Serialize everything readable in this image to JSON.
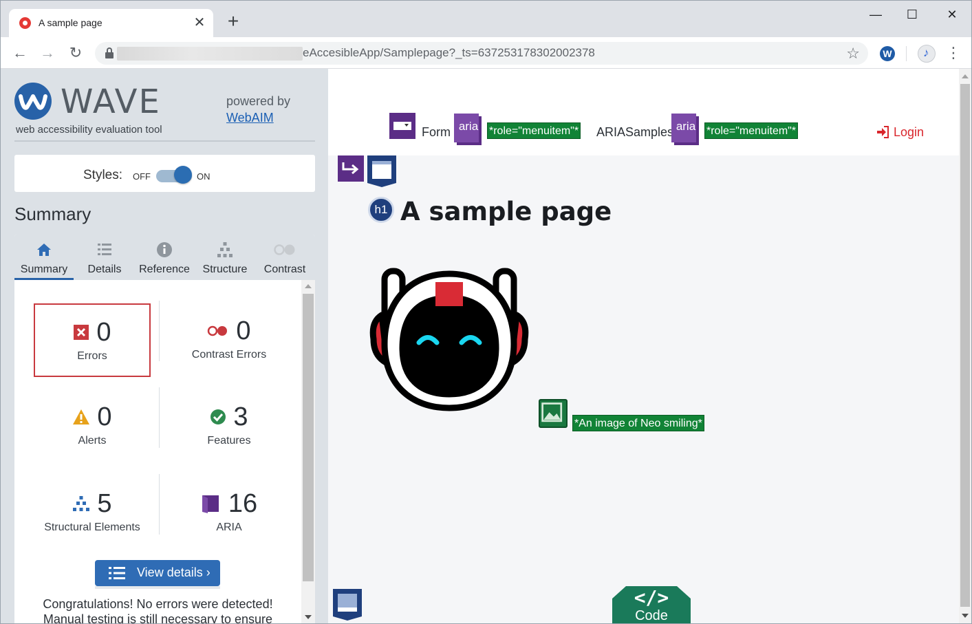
{
  "browser": {
    "tab_title": "A sample page",
    "tab_close": "✕",
    "new_tab": "+",
    "url_visible": "eAccesibleApp/Samplepage?_ts=637253178302002378",
    "window_controls": {
      "minimize": "—",
      "maximize": "☐",
      "close": "✕"
    },
    "nav": {
      "back": "←",
      "forward": "→",
      "reload": "↻"
    },
    "bookmark": "☆",
    "extension_icon": "W",
    "menu": "⋮",
    "favicon_color": "#e53935"
  },
  "wave": {
    "title": "WAVE",
    "subtitle": "web accessibility evaluation tool",
    "powered_by": "powered by",
    "powered_link": "WebAIM",
    "styles": {
      "label": "Styles:",
      "off": "OFF",
      "on": "ON",
      "state": "on"
    },
    "summary_heading": "Summary",
    "tabs": [
      {
        "label": "Summary",
        "icon": "home-icon",
        "active": true
      },
      {
        "label": "Details",
        "icon": "list-icon",
        "active": false
      },
      {
        "label": "Reference",
        "icon": "info-icon",
        "active": false
      },
      {
        "label": "Structure",
        "icon": "hierarchy-icon",
        "active": false
      },
      {
        "label": "Contrast",
        "icon": "contrast-icon",
        "active": false
      }
    ],
    "stats": {
      "errors": {
        "value": "0",
        "label": "Errors",
        "color": "#c8393e"
      },
      "contrast_errors": {
        "value": "0",
        "label": "Contrast Errors",
        "color": "#c8393e"
      },
      "alerts": {
        "value": "0",
        "label": "Alerts",
        "color": "#e7a21b"
      },
      "features": {
        "value": "3",
        "label": "Features",
        "color": "#2e8b4f"
      },
      "structural": {
        "value": "5",
        "label": "Structural Elements",
        "color": "#2f6cb5"
      },
      "aria": {
        "value": "16",
        "label": "ARIA",
        "color": "#5b2d86"
      }
    },
    "view_details": "View details ›",
    "congrats_line1": "Congratulations! No errors were detected!",
    "congrats_line2": "Manual testing is still necessary to ensure"
  },
  "page": {
    "nav_form": "Form",
    "aria_badge": "aria",
    "role_label": "*role=\"menuitem\"*",
    "nav_aria_samples": "ARIASamples",
    "login": "Login",
    "heading_badge": "h1",
    "heading": "A sample page",
    "image_alt_label": "*An image of Neo smiling*",
    "code_symbol": "</>",
    "code_label": "Code"
  }
}
